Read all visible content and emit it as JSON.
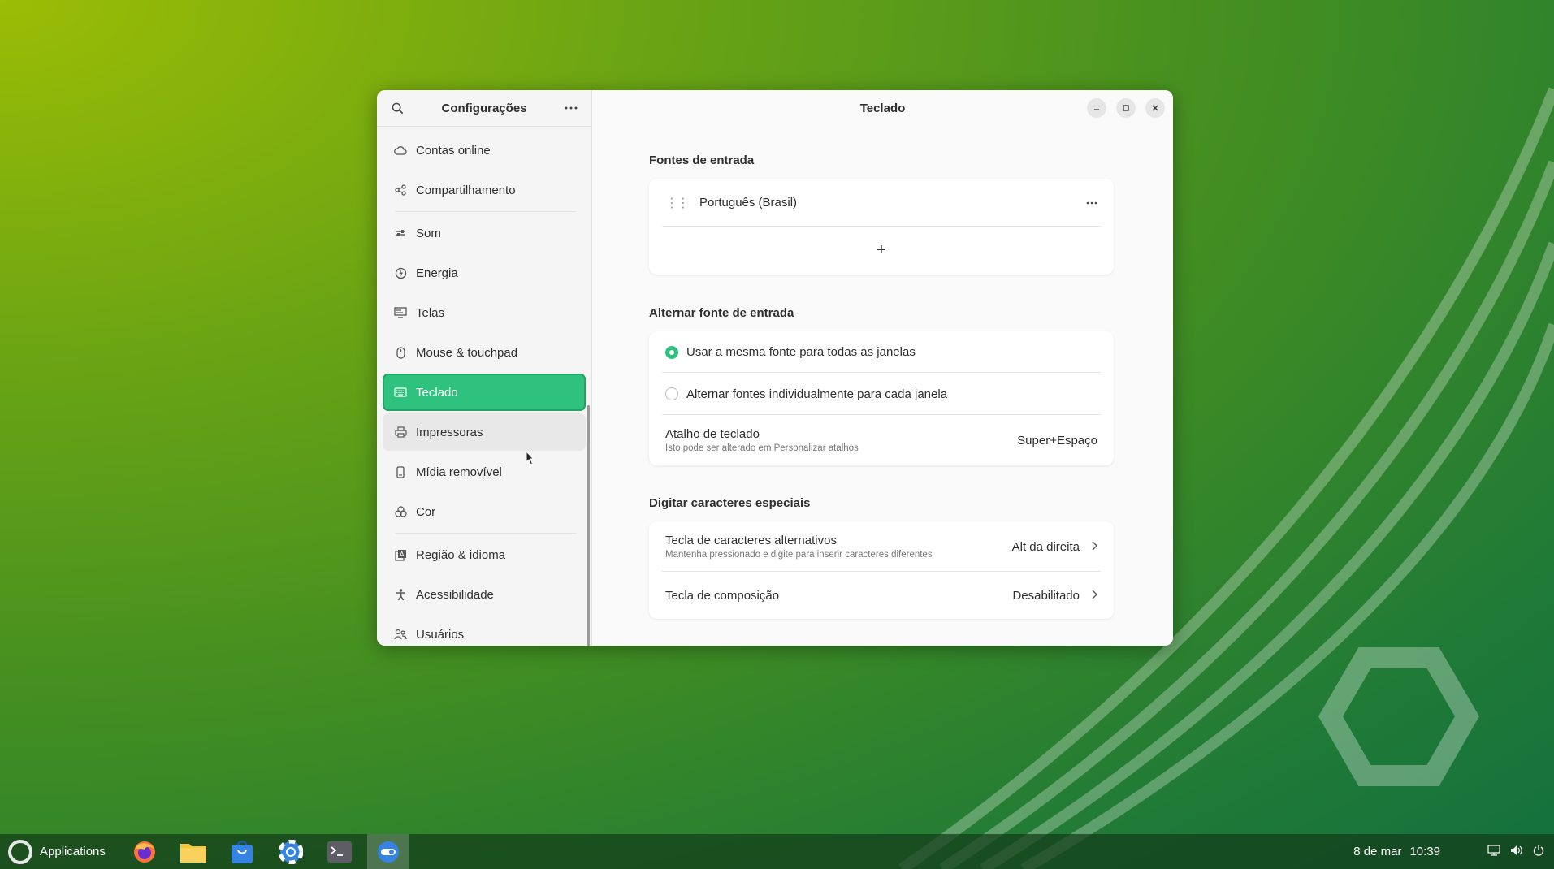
{
  "window": {
    "sidebar_title": "Configurações",
    "content_title": "Teclado"
  },
  "sidebar": {
    "items": [
      {
        "label": "Contas online",
        "icon": "cloud-icon"
      },
      {
        "label": "Compartilhamento",
        "icon": "share-icon"
      },
      {
        "label": "Som",
        "icon": "sound-icon"
      },
      {
        "label": "Energia",
        "icon": "power-icon"
      },
      {
        "label": "Telas",
        "icon": "display-icon"
      },
      {
        "label": "Mouse & touchpad",
        "icon": "mouse-icon"
      },
      {
        "label": "Teclado",
        "icon": "keyboard-icon",
        "active": true
      },
      {
        "label": "Impressoras",
        "icon": "printer-icon"
      },
      {
        "label": "Mídia removível",
        "icon": "usb-icon"
      },
      {
        "label": "Cor",
        "icon": "color-icon"
      },
      {
        "label": "Região & idioma",
        "icon": "region-icon"
      },
      {
        "label": "Acessibilidade",
        "icon": "accessibility-icon"
      },
      {
        "label": "Usuários",
        "icon": "users-icon"
      }
    ]
  },
  "input_sources": {
    "title": "Fontes de entrada",
    "items": [
      "Português (Brasil)"
    ],
    "add_label": "+"
  },
  "switch_source": {
    "title": "Alternar fonte de entrada",
    "option_same": "Usar a mesma fonte para todas as janelas",
    "option_individual": "Alternar fontes individualmente para cada janela",
    "selected": "option_same",
    "shortcut_label": "Atalho de teclado",
    "shortcut_sub": "Isto pode ser alterado em Personalizar atalhos",
    "shortcut_value": "Super+Espaço"
  },
  "special_chars": {
    "title": "Digitar caracteres especiais",
    "alt_key_label": "Tecla de caracteres alternativos",
    "alt_key_sub": "Mantenha pressionado e digite para inserir caracteres diferentes",
    "alt_key_value": "Alt da direita",
    "compose_label": "Tecla de composição",
    "compose_value": "Desabilitado"
  },
  "taskbar": {
    "applications_label": "Applications",
    "date": "8 de mar",
    "time": "10:39"
  },
  "colors": {
    "accent": "#2ec27e",
    "taskbar": "#143c19"
  }
}
